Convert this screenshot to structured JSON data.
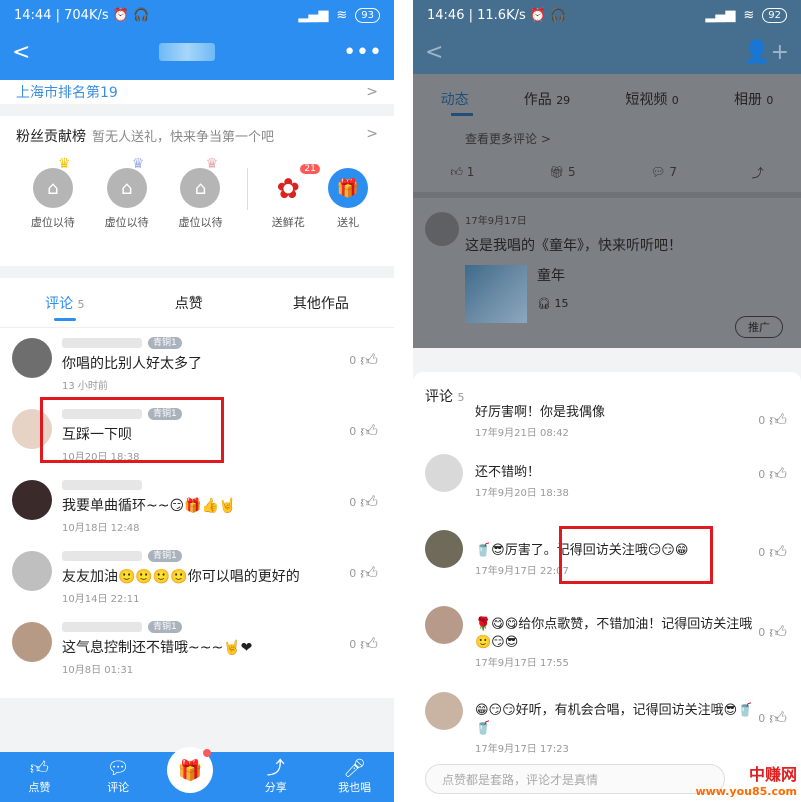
{
  "left": {
    "status": {
      "time": "14:44",
      "speed": "704K/s",
      "battery": "93"
    },
    "nav": {
      "back": "<",
      "more": "•••"
    },
    "rank_text": "上海市排名第19",
    "fans": {
      "title": "粉丝贡献榜",
      "subtitle": "暂无人送礼，快来争当第一个吧",
      "seats": [
        "虚位以待",
        "虚位以待",
        "虚位以待"
      ],
      "gift_label": "送鲜花",
      "gift_count": "21",
      "send_label": "送礼"
    },
    "tabs": {
      "comments": "评论",
      "comments_count": "5",
      "likes": "点赞",
      "others": "其他作品"
    },
    "comments": [
      {
        "level": "青铜1",
        "text": "你唱的比别人好太多了",
        "time": "13 小时前",
        "likes": "0"
      },
      {
        "level": "青铜1",
        "text": "互踩一下呗",
        "time": "10月20日 18:38",
        "likes": "0"
      },
      {
        "level": "",
        "text": "我要单曲循环~~😏🎁👍🤘",
        "time": "10月18日 12:48",
        "likes": "0"
      },
      {
        "level": "青铜1",
        "text": "友友加油🙂🙂🙂🙂你可以唱的更好的",
        "time": "10月14日 22:11",
        "likes": "0"
      },
      {
        "level": "青铜1",
        "text": "这气息控制还不错哦~~~🤘❤",
        "time": "10月8日 01:31",
        "likes": "0"
      }
    ],
    "bottom": [
      "点赞",
      "评论",
      "分享",
      "我也唱"
    ]
  },
  "right": {
    "status": {
      "time": "14:46",
      "speed": "11.6K/s",
      "battery": "92"
    },
    "tabs": [
      {
        "label": "动态",
        "count": ""
      },
      {
        "label": "作品",
        "count": "29"
      },
      {
        "label": "短视频",
        "count": "0"
      },
      {
        "label": "相册",
        "count": "0"
      }
    ],
    "more_comments": "查看更多评论 >",
    "actions": {
      "like": "1",
      "gift": "5",
      "comment": "7"
    },
    "feed": {
      "date": "17年9月17日",
      "text": "这是我唱的《童年》，快来听听吧！",
      "song": "童年",
      "plays": "15",
      "promo": "推广"
    },
    "sheet": {
      "title": "评论",
      "count": "5",
      "comments": [
        {
          "text": "好厉害啊！你是我偶像",
          "time": "17年9月21日 08:42",
          "likes": "0"
        },
        {
          "text": "还不错哟！",
          "time": "17年9月20日 18:38",
          "likes": "0"
        },
        {
          "text": "🥤😎厉害了。记得回访关注哦😏😏😁",
          "time": "17年9月17日 22:07",
          "likes": "0"
        },
        {
          "text": "🌹😋😋给你点歌赞，不错加油！记得回访关注哦🙂😏😎",
          "time": "17年9月17日 17:55",
          "likes": "0"
        },
        {
          "text": "😁😏😏好听，有机会合唱，记得回访关注哦😎🥤🥤",
          "time": "17年9月17日 17:23",
          "likes": "0"
        }
      ],
      "input_placeholder": "点赞都是套路，评论才是真情"
    },
    "watermark": {
      "name": "中赚网",
      "url": "www.you85.com"
    }
  }
}
